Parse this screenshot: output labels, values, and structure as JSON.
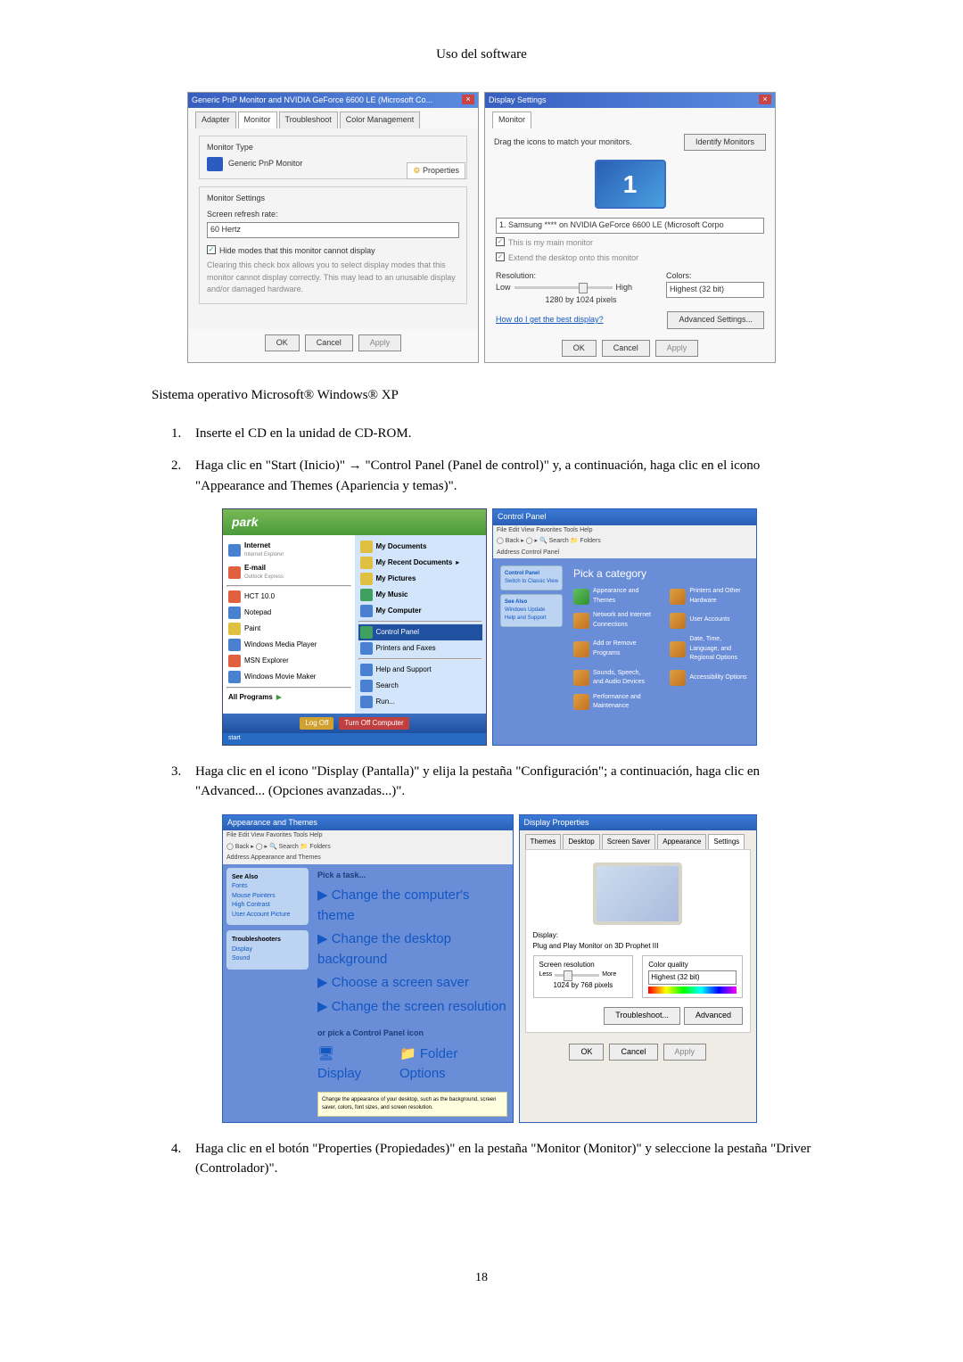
{
  "header": "Uso del software",
  "monitor_dialog": {
    "title": "Generic PnP Monitor and NVIDIA GeForce 6600 LE (Microsoft Co...",
    "tabs": [
      "Adapter",
      "Monitor",
      "Troubleshoot",
      "Color Management"
    ],
    "monitor_type_label": "Monitor Type",
    "monitor_name": "Generic PnP Monitor",
    "properties_btn": "Properties",
    "settings_label": "Monitor Settings",
    "refresh_label": "Screen refresh rate:",
    "refresh_value": "60 Hertz",
    "hide_modes_label": "Hide modes that this monitor cannot display",
    "hide_modes_desc": "Clearing this check box allows you to select display modes that this monitor cannot display correctly. This may lead to an unusable display and/or damaged hardware.",
    "ok": "OK",
    "cancel": "Cancel",
    "apply": "Apply"
  },
  "display_settings": {
    "title": "Display Settings",
    "tab": "Monitor",
    "drag_text": "Drag the icons to match your monitors.",
    "identify_btn": "Identify Monitors",
    "monitor_number": "1",
    "monitor_desc": "1. Samsung **** on NVIDIA GeForce 6600 LE (Microsoft Corpo",
    "main_monitor": "This is my main monitor",
    "extend_desktop": "Extend the desktop onto this monitor",
    "resolution_label": "Resolution:",
    "low": "Low",
    "high": "High",
    "resolution_value": "1280 by 1024 pixels",
    "colors_label": "Colors:",
    "colors_value": "Highest (32 bit)",
    "help_link": "How do I get the best display?",
    "advanced_btn": "Advanced Settings...",
    "ok": "OK",
    "cancel": "Cancel",
    "apply": "Apply"
  },
  "os_caption": "Sistema operativo Microsoft® Windows® XP",
  "steps": {
    "1": "Inserte el CD en la unidad de CD-ROM.",
    "2": "Haga clic en \"Start (Inicio)\" → \"Control Panel (Panel de control)\" y, a continuación, haga clic en el icono \"Appearance and Themes (Apariencia y temas)\".",
    "3": "Haga clic en el icono \"Display (Pantalla)\" y elija la pestaña \"Configuración\"; a continuación, haga clic en \"Advanced... (Opciones avanzadas...)\".",
    "4": "Haga clic en el botón \"Properties (Propiedades)\" en la pestaña \"Monitor (Monitor)\" y seleccione la pestaña \"Driver (Controlador)\"."
  },
  "start_menu": {
    "user": "park",
    "left_items": [
      "Internet",
      "E-mail",
      "HCT 10.0",
      "Notepad",
      "Paint",
      "Windows Media Player",
      "MSN Explorer",
      "Windows Movie Maker",
      "All Programs"
    ],
    "left_sub": [
      "Internet Explorer",
      "Outlook Express"
    ],
    "right_items": [
      "My Documents",
      "My Recent Documents",
      "My Pictures",
      "My Music",
      "My Computer",
      "Control Panel",
      "Printers and Faxes",
      "Help and Support",
      "Search",
      "Run..."
    ],
    "logoff": "Log Off",
    "turnoff": "Turn Off Computer",
    "taskbar": "start"
  },
  "control_panel": {
    "title": "Control Panel",
    "address": "Control Panel",
    "heading": "Pick a category",
    "side_title": "Control Panel",
    "categories": [
      "Appearance and Themes",
      "Network and Internet Connections",
      "Add or Remove Programs",
      "Sounds, Speech, and Audio Devices",
      "Performance and Maintenance",
      "Printers and Other Hardware",
      "User Accounts",
      "Date, Time, Language, and Regional Options",
      "Accessibility Options"
    ]
  },
  "themes_window": {
    "title": "Appearance and Themes",
    "heading_task": "Pick a task...",
    "tasks": [
      "Change the computer's theme",
      "Change the desktop background",
      "Choose a screen saver",
      "Change the screen resolution"
    ],
    "heading_cp": "or pick a Control Panel icon",
    "cp_icons": [
      "Display",
      "Folder Options"
    ],
    "cp_desc": "Change the appearance of your desktop, such as the background, screen saver, colors, font sizes, and screen resolution."
  },
  "display_properties": {
    "title": "Display Properties",
    "tabs": [
      "Themes",
      "Desktop",
      "Screen Saver",
      "Appearance",
      "Settings"
    ],
    "display_label": "Display:",
    "display_name": "Plug and Play Monitor on 3D Prophet III",
    "screen_res_label": "Screen resolution",
    "less": "Less",
    "more": "More",
    "res_value": "1024 by 768 pixels",
    "color_label": "Color quality",
    "color_value": "Highest (32 bit)",
    "troubleshoot": "Troubleshoot...",
    "advanced": "Advanced",
    "ok": "OK",
    "cancel": "Cancel",
    "apply": "Apply"
  },
  "page_number": "18"
}
